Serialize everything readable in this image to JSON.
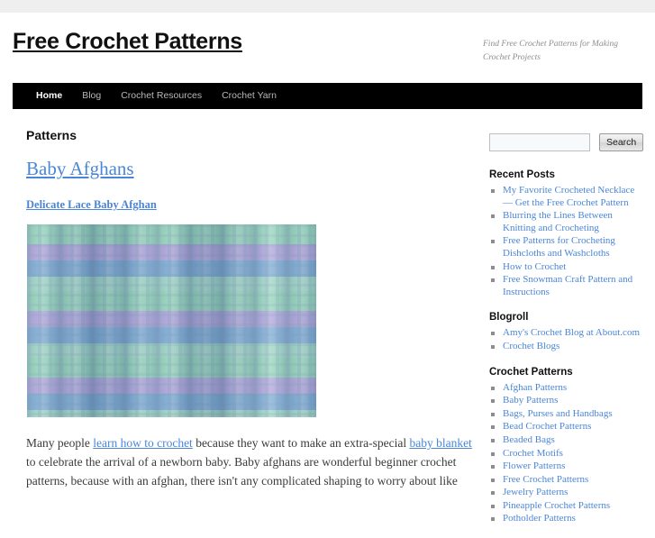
{
  "site": {
    "title": "Free Crochet Patterns",
    "tagline": "Find Free Crochet Patterns for Making Crochet Projects"
  },
  "nav": {
    "items": [
      {
        "label": "Home",
        "active": true
      },
      {
        "label": "Blog",
        "active": false
      },
      {
        "label": "Crochet Resources",
        "active": false
      },
      {
        "label": "Crochet Yarn",
        "active": false
      }
    ]
  },
  "main": {
    "page_title": "Patterns",
    "entry_title": "Baby Afghans",
    "sub_title": "Delicate Lace Baby Afghan",
    "image_alt": "Delicate lace baby afghan crocheted in green, purple and blue striped yarn",
    "paragraph": {
      "part1": "Many people ",
      "link1": "learn how to crochet",
      "part2": " because they want to make an extra-special ",
      "link2": "baby blanket",
      "part3": " to celebrate the arrival of a newborn baby. Baby afghans are wonderful beginner crochet patterns, because with an afghan, there isn't any complicated shaping to worry about like"
    }
  },
  "sidebar": {
    "search": {
      "value": "",
      "placeholder": "",
      "button_label": "Search"
    },
    "widgets": [
      {
        "title": "Recent Posts",
        "items": [
          "My Favorite Crocheted Necklace — Get the Free Crochet Pattern",
          "Blurring the Lines Between Knitting and Crocheting",
          "Free Patterns for Crocheting Dishcloths and Washcloths",
          "How to Crochet",
          "Free Snowman Craft Pattern and Instructions"
        ]
      },
      {
        "title": "Blogroll",
        "items": [
          "Amy's Crochet Blog at About.com",
          "Crochet Blogs"
        ]
      },
      {
        "title": "Crochet Patterns",
        "items": [
          "Afghan Patterns",
          "Baby Patterns",
          "Bags, Purses and Handbags",
          "Bead Crochet Patterns",
          "Beaded Bags",
          "Crochet Motifs",
          "Flower Patterns",
          "Free Crochet Patterns",
          "Jewelry Patterns",
          "Pineapple Crochet Patterns",
          "Potholder Patterns"
        ]
      }
    ]
  },
  "colors": {
    "link": "#4a86d8",
    "nav_background": "#000000",
    "top_band": "#efefef",
    "tagline": "#8d8d8d"
  }
}
